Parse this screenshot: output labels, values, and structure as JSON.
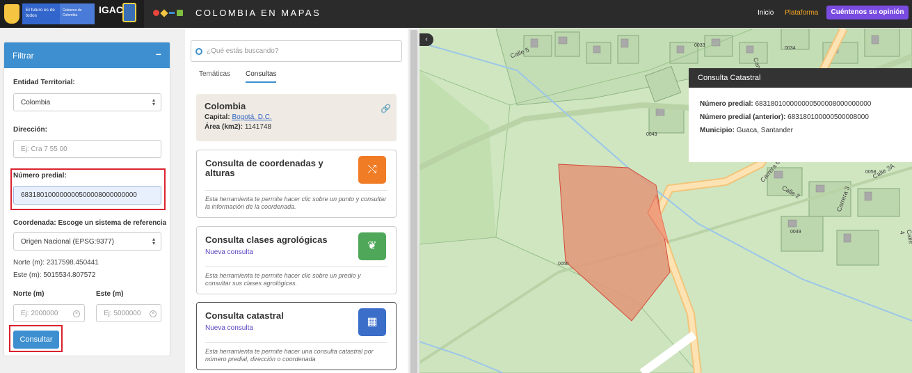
{
  "topbar": {
    "futuro_text": "El futuro es de todos",
    "gobierno_text": "Gobierno de Colombia",
    "igac": "IGAC",
    "brand": "COLOMBIA EN MAPAS",
    "nav_inicio": "Inicio",
    "nav_plataforma": "Plataforma",
    "feedback_button": "Cuéntenos su opinión"
  },
  "filter": {
    "title": "Filtrar",
    "collapse_symbol": "−",
    "entidad_label": "Entidad Territorial:",
    "entidad_value": "Colombia",
    "direccion_label": "Dirección:",
    "direccion_placeholder": "Ej: Cra 7 55 00",
    "predial_label": "Número predial:",
    "predial_value": "683180100000000500008000000000",
    "coordenada_label": "Coordenada: Escoge un sistema de referencia",
    "coordenada_value": "Origen Nacional (EPSG:9377)",
    "norte_readout": "Norte (m): 2317598.450441",
    "este_readout": "Este (m): 5015534.807572",
    "norte_label": "Norte (m)",
    "este_label": "Este (m)",
    "norte_placeholder": "Ej: 2000000",
    "este_placeholder": "Ej: 5000000",
    "consultar_button": "Consultar"
  },
  "middle": {
    "search_placeholder": "¿Qué estás buscando?",
    "tabs": [
      {
        "label": "Temáticas"
      },
      {
        "label": "Consultas"
      }
    ],
    "colombia_card": {
      "title": "Colombia",
      "capital_label": "Capital:",
      "capital_value": "Bogotá, D.C.",
      "area_label": "Área (km2):",
      "area_value": "1141748"
    },
    "tools": [
      {
        "title": "Consulta de coordenadas y alturas",
        "subtitle": "",
        "description": "Esta herramienta te permite hacer clic sobre un punto y consultar la información de la coordenada.",
        "icon": "arrows-icon",
        "color": "#f07c26"
      },
      {
        "title": "Consulta clases agrológicas",
        "subtitle": "Nueva consulta",
        "description": "Esta herramienta te permite hacer clic sobre un predio y consultar sus clases agrológicas.",
        "icon": "plant-icon",
        "color": "#4fa85a"
      },
      {
        "title": "Consulta catastral",
        "subtitle": "Nueva consulta",
        "description": "Esta herramienta te permite hacer una consulta catastral por número predial, dirección o coordenada",
        "icon": "layout-icon",
        "color": "#3a6ec9"
      }
    ]
  },
  "map": {
    "labels": {
      "street_calle5": "Calle 5",
      "street_carrera4": "Carrera 4",
      "street_carrera6": "Carrera 6",
      "street_calle2": "Calle 2",
      "street_carrera3": "Carrera 3",
      "street_calle3a": "Calle 3A",
      "street_calle4": "Calle 4",
      "p0033": "0033",
      "p0034": "0034",
      "p0043": "0043",
      "p0058": "0058",
      "p0049": "0049",
      "p0050": "0050"
    },
    "popup": {
      "title": "Consulta Catastral",
      "numero_label": "Número predial:",
      "numero_value": "683180100000000500008000000000",
      "anterior_label": "Número predial (anterior):",
      "anterior_value": "683180100000500008000",
      "municipio_label": "Municipio:",
      "municipio_value": "Guaca, Santander"
    }
  }
}
